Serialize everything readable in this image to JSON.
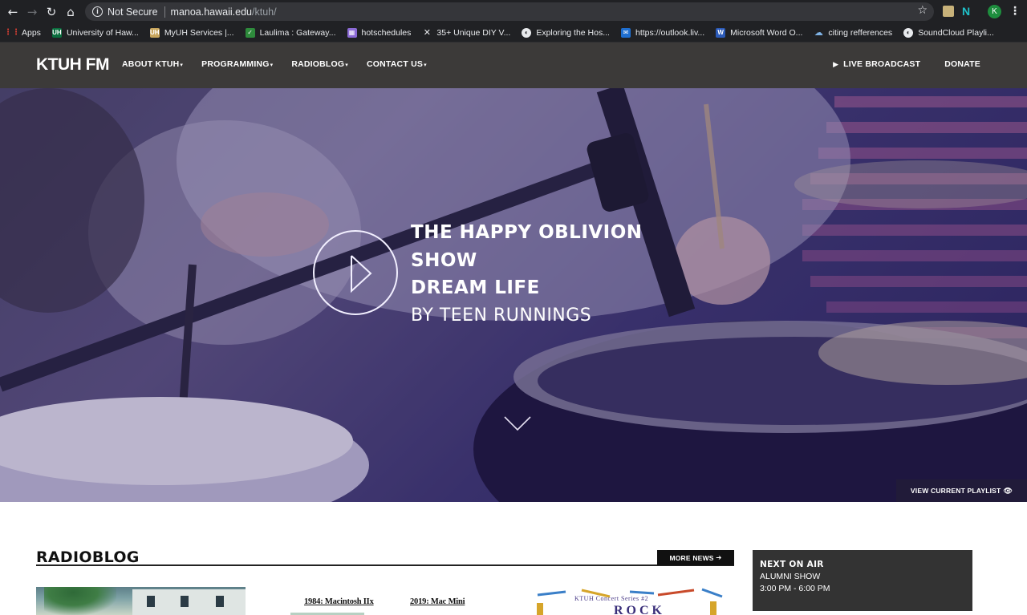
{
  "browser": {
    "security_label": "Not Secure",
    "url_host": "manoa.hawaii.edu",
    "url_path": "/ktuh/",
    "profile_initial": "K",
    "bookmarks": [
      {
        "label": "Apps",
        "icon": "apps-grid-icon",
        "color": "#e8eaed"
      },
      {
        "label": "University of Haw...",
        "icon": "uh-icon",
        "color": "#0a6e3e"
      },
      {
        "label": "MyUH Services |...",
        "icon": "myuh-icon",
        "color": "#c8a55b"
      },
      {
        "label": "Laulima : Gateway...",
        "icon": "laulima-icon",
        "color": "#2e8b3c"
      },
      {
        "label": "hotschedules",
        "icon": "hotschedules-icon",
        "color": "#8c6bd6"
      },
      {
        "label": "35+ Unique DIY V...",
        "icon": "x-icon",
        "color": "#e8eaed"
      },
      {
        "label": "Exploring the Hos...",
        "icon": "globe-icon",
        "color": "#e8eaed"
      },
      {
        "label": "https://outlook.liv...",
        "icon": "outlook-icon",
        "color": "#1f6fd1"
      },
      {
        "label": "Microsoft Word O...",
        "icon": "word-icon",
        "color": "#2b5ab8"
      },
      {
        "label": "citing refferences",
        "icon": "cloud-icon",
        "color": "#7fb3e6"
      },
      {
        "label": "SoundCloud Playli...",
        "icon": "globe-icon",
        "color": "#e8eaed"
      }
    ]
  },
  "site": {
    "logo": "KTUH FM",
    "nav": [
      {
        "label": "ABOUT KTUH"
      },
      {
        "label": "PROGRAMMING"
      },
      {
        "label": "RADIOBLOG"
      },
      {
        "label": "CONTACT US"
      }
    ],
    "live_broadcast": "LIVE BROADCAST",
    "donate": "DONATE"
  },
  "hero": {
    "show_line1": "THE HAPPY OBLIVION",
    "show_line2": "SHOW",
    "song": "DREAM LIFE",
    "artist": "BY TEEN RUNNINGS",
    "playlist_button": "VIEW CURRENT PLAYLIST"
  },
  "radioblog": {
    "title": "RADIOBLOG",
    "more_news": "MORE NEWS",
    "captions": [
      "1984: Macintosh IIx",
      "2019: Mac Mini"
    ],
    "concert_label": "KTUH Concert Series #2"
  },
  "next_on_air": {
    "label": "NEXT ON AIR",
    "show": "ALUMNI SHOW",
    "time": "3:00 PM - 6:00 PM"
  },
  "colors": {
    "header_bg": "#3c3a39",
    "hero_tint": "#3e3770",
    "next_on_air_bg": "#333333"
  }
}
